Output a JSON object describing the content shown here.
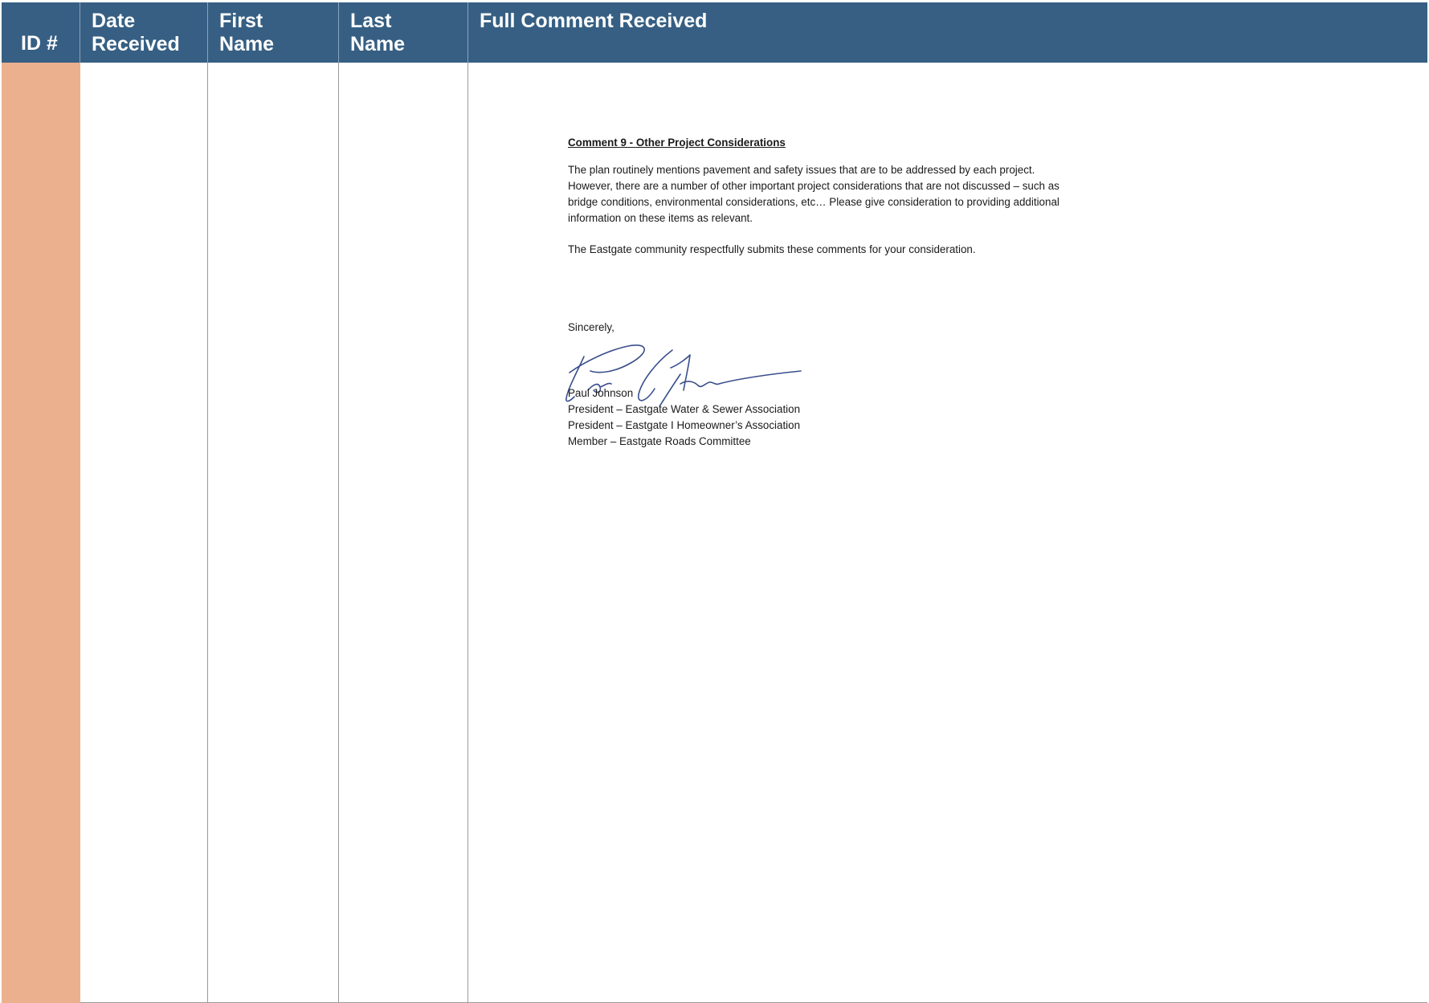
{
  "header": {
    "id": "ID #",
    "date_received": [
      "Date",
      "Received"
    ],
    "first_name": [
      "First",
      "Name"
    ],
    "last_name": [
      "Last",
      "Name"
    ],
    "full_comment": "Full Comment Received"
  },
  "row": {
    "id": "",
    "date_received": "",
    "first_name": "",
    "last_name": ""
  },
  "comment": {
    "title": "Comment 9 - Other Project Considerations",
    "paragraph1": [
      "The plan routinely mentions pavement and safety issues that are to be addressed by each project.",
      "However, there are a number of other important project considerations that are not discussed – such as",
      "bridge conditions, environmental considerations, etc…  Please give consideration to providing additional",
      "information on these items as relevant."
    ],
    "paragraph2": "The Eastgate community respectfully submits these comments for your consideration.",
    "closing": "Sincerely,",
    "signature_lines": [
      "Paul Johnson",
      "President – Eastgate Water & Sewer Association",
      "President – Eastgate I Homeowner’s Association",
      "Member – Eastgate Roads Committee"
    ]
  },
  "colors": {
    "header_bg": "#365f83",
    "id_column_bg": "#ebb08e",
    "signature_ink": "#3a4f8c"
  }
}
